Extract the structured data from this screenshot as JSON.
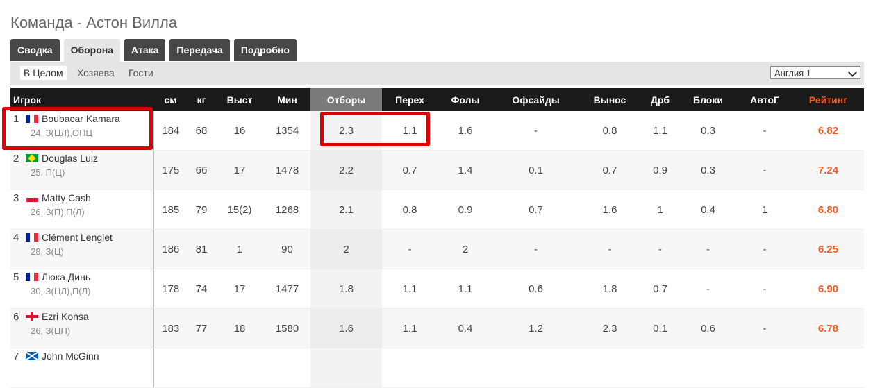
{
  "page": {
    "title": "Команда - Астон Вилла"
  },
  "tabs": [
    "Сводка",
    "Оборона",
    "Атака",
    "Передача",
    "Подробно"
  ],
  "subfilters": [
    "В Целом",
    "Хозяева",
    "Гости"
  ],
  "league_select": {
    "value": "Англия 1"
  },
  "columns": [
    "Игрок",
    "см",
    "кг",
    "Выст",
    "Мин",
    "Отборы",
    "Перех",
    "Фолы",
    "Офсайды",
    "Вынос",
    "Дрб",
    "Блоки",
    "АвтоГ",
    "Рейтинг"
  ],
  "colors": {
    "accent": "#f15a24",
    "header_bg": "#1b1b1b",
    "tab_bg": "#474747",
    "highlight": "#e00000"
  },
  "rows": [
    {
      "rank": "1",
      "flag": "france-flag",
      "name": "Boubacar Kamara",
      "info": "24, З(ЦЛ),ОПЦ",
      "cm": "184",
      "kg": "68",
      "apps": "16",
      "mins": "1354",
      "tackles": "2.3",
      "inter": "1.1",
      "fouls": "1.6",
      "offsides": "-",
      "clear": "0.8",
      "drb": "1.1",
      "blocks": "0.3",
      "og": "-",
      "rating": "6.82"
    },
    {
      "rank": "2",
      "flag": "brazil-flag",
      "name": "Douglas Luiz",
      "info": "25, П(Ц)",
      "cm": "175",
      "kg": "66",
      "apps": "17",
      "mins": "1478",
      "tackles": "2.2",
      "inter": "0.7",
      "fouls": "1.4",
      "offsides": "0.1",
      "clear": "0.7",
      "drb": "0.9",
      "blocks": "0.3",
      "og": "-",
      "rating": "7.24"
    },
    {
      "rank": "3",
      "flag": "poland-flag",
      "name": "Matty Cash",
      "info": "26, З(П),П(Л)",
      "cm": "185",
      "kg": "79",
      "apps": "15(2)",
      "mins": "1268",
      "tackles": "2.1",
      "inter": "0.8",
      "fouls": "0.9",
      "offsides": "0.7",
      "clear": "1.6",
      "drb": "1",
      "blocks": "0.4",
      "og": "1",
      "rating": "6.80"
    },
    {
      "rank": "4",
      "flag": "france-flag",
      "name": "Clément Lenglet",
      "info": "28, З(Ц)",
      "cm": "186",
      "kg": "81",
      "apps": "1",
      "mins": "90",
      "tackles": "2",
      "inter": "-",
      "fouls": "2",
      "offsides": "-",
      "clear": "-",
      "drb": "-",
      "blocks": "-",
      "og": "-",
      "rating": "6.25"
    },
    {
      "rank": "5",
      "flag": "france-flag",
      "name": "Люка Динь",
      "info": "30, З(ЦЛ),П(Л)",
      "cm": "178",
      "kg": "74",
      "apps": "17",
      "mins": "1477",
      "tackles": "1.8",
      "inter": "1.1",
      "fouls": "1.1",
      "offsides": "0.6",
      "clear": "1.8",
      "drb": "0.7",
      "blocks": "-",
      "og": "-",
      "rating": "6.90"
    },
    {
      "rank": "6",
      "flag": "england-flag",
      "name": "Ezri Konsa",
      "info": "26, З(ЦП)",
      "cm": "183",
      "kg": "77",
      "apps": "18",
      "mins": "1580",
      "tackles": "1.6",
      "inter": "1.1",
      "fouls": "0.4",
      "offsides": "1.2",
      "clear": "2.3",
      "drb": "0.1",
      "blocks": "0.6",
      "og": "-",
      "rating": "6.78"
    },
    {
      "rank": "7",
      "flag": "scotland-flag",
      "name": "John McGinn",
      "info": "",
      "cm": "",
      "kg": "",
      "apps": "",
      "mins": "",
      "tackles": "",
      "inter": "",
      "fouls": "",
      "offsides": "",
      "clear": "",
      "drb": "",
      "blocks": "",
      "og": "",
      "rating": ""
    }
  ]
}
